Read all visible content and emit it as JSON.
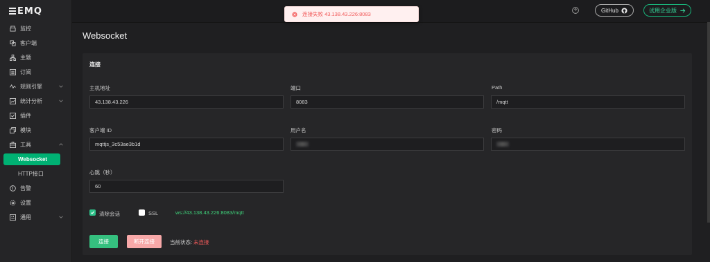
{
  "app": {
    "logo": "EMQ"
  },
  "sidebar": {
    "items": [
      {
        "label": "监控",
        "icon": "monitor-icon"
      },
      {
        "label": "客户端",
        "icon": "clients-icon"
      },
      {
        "label": "主题",
        "icon": "topics-icon"
      },
      {
        "label": "订阅",
        "icon": "subscriptions-icon"
      },
      {
        "label": "规则引擎",
        "icon": "rule-engine-icon",
        "expandable": true
      },
      {
        "label": "统计分析",
        "icon": "analytics-icon",
        "expandable": true
      },
      {
        "label": "插件",
        "icon": "plugins-icon"
      },
      {
        "label": "模块",
        "icon": "modules-icon"
      },
      {
        "label": "工具",
        "icon": "tools-icon",
        "expanded": true
      },
      {
        "label": "Websocket",
        "active": true
      },
      {
        "label": "HTTP接口"
      },
      {
        "label": "告警",
        "icon": "alarm-icon"
      },
      {
        "label": "设置",
        "icon": "settings-icon"
      },
      {
        "label": "通用",
        "icon": "general-icon",
        "expandable": true
      }
    ]
  },
  "header": {
    "github_label": "GitHub",
    "trial_label": "试用企业版"
  },
  "toast": {
    "message": "连接失败 43.138.43.226:8083",
    "type": "error"
  },
  "page": {
    "title": "Websocket"
  },
  "connection": {
    "section_title": "连接",
    "host_label": "主机地址",
    "host_value": "43.138.43.226",
    "port_label": "端口",
    "port_value": "8083",
    "path_label": "Path",
    "path_value": "/mqtt",
    "client_id_label": "客户端 ID",
    "client_id_value": "mqttjs_3c53ae3b1d",
    "username_label": "用户名",
    "password_label": "密码",
    "keepalive_label": "心跳（秒）",
    "keepalive_value": "60",
    "clean_session_label": "清除会话",
    "clean_session_checked": true,
    "ssl_label": "SSL",
    "ssl_checked": false,
    "ws_url": "ws://43.138.43.226:8083/mqtt",
    "connect_label": "连接",
    "disconnect_label": "断开连接",
    "status_label": "当前状态:",
    "status_value": "未连接"
  },
  "colors": {
    "accent": "#00b173",
    "error": "#f45b5b",
    "link": "#3fd17a"
  }
}
